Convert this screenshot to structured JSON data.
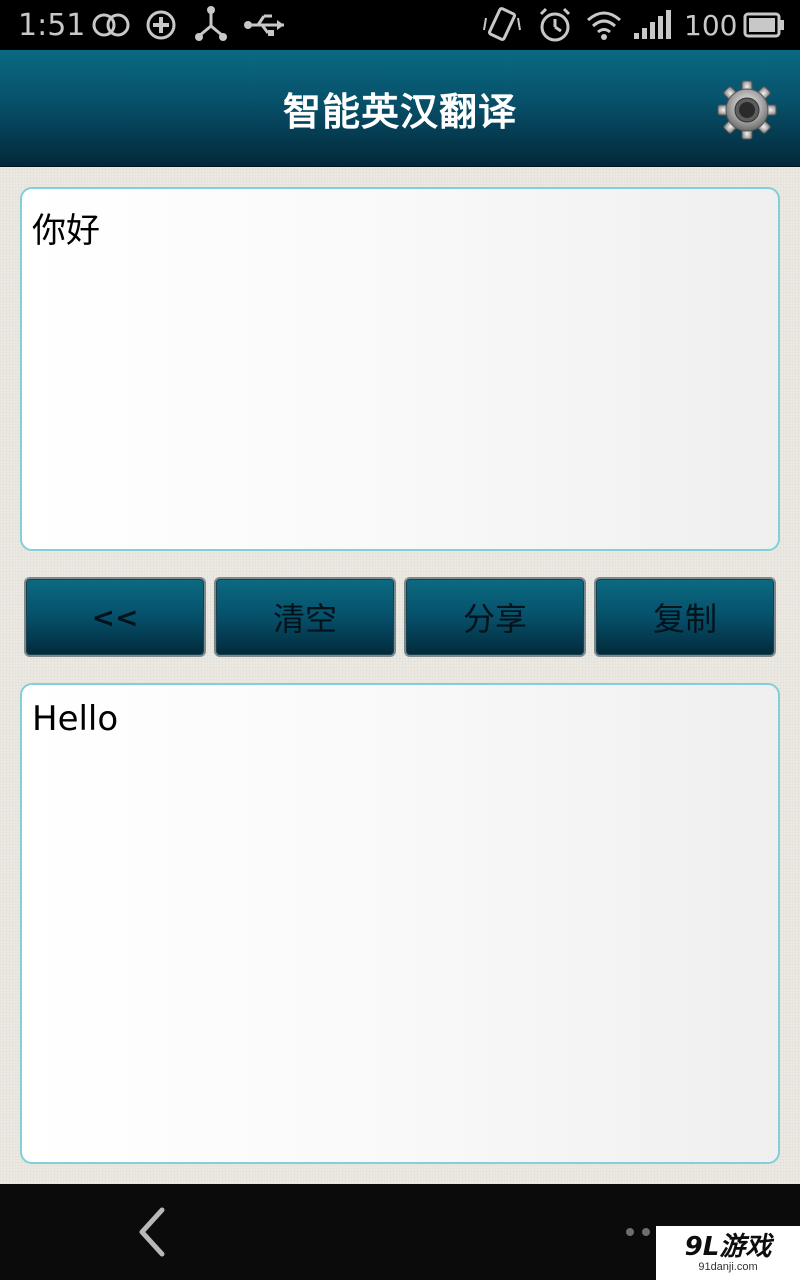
{
  "status_bar": {
    "time": "1:51",
    "battery_level": "100",
    "icons": [
      "double-ring-icon",
      "sync-plus-icon",
      "usb-tether-icon",
      "usb-icon",
      "vibrate-icon",
      "alarm-icon",
      "wifi-icon",
      "signal-icon",
      "battery-icon"
    ]
  },
  "header": {
    "title": "智能英汉翻译",
    "settings_icon": "gear-icon"
  },
  "input": {
    "value": "你好"
  },
  "buttons": {
    "back": "<<",
    "clear": "清空",
    "share": "分享",
    "copy": "复制"
  },
  "output": {
    "value": "Hello"
  },
  "watermark": {
    "main": "9L游戏",
    "sub": "91danji.com"
  },
  "colors": {
    "header_top": "#0a6a83",
    "header_bottom": "#03293a",
    "textbox_border": "#7fd0dc",
    "background": "#ece9e2"
  }
}
